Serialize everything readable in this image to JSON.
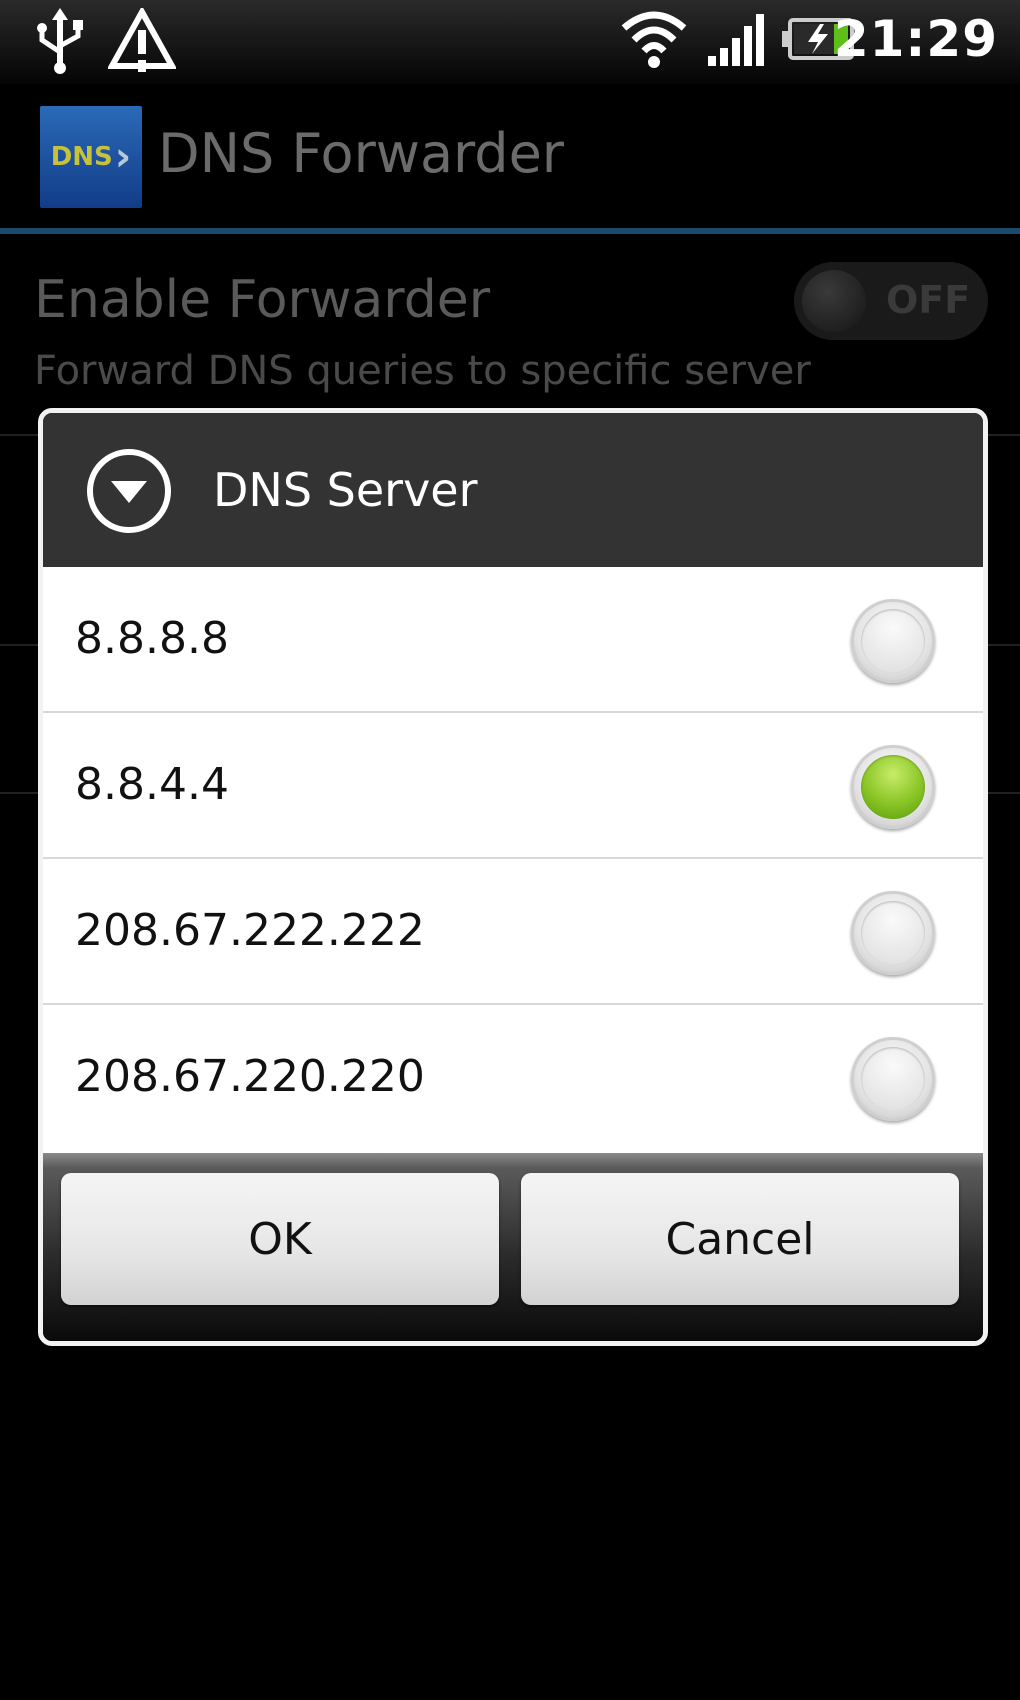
{
  "status_bar": {
    "time": "21:29",
    "icons": [
      "usb-icon",
      "warning-icon",
      "wifi-icon",
      "signal-icon",
      "battery-charging-icon"
    ]
  },
  "app": {
    "logo_text": "DNS",
    "title": "DNS Forwarder"
  },
  "preferences": {
    "enable_forwarder": {
      "title": "Enable Forwarder",
      "summary": "Forward DNS queries to specific server",
      "toggle_label": "OFF"
    }
  },
  "dialog": {
    "title": "DNS Server",
    "options": [
      {
        "label": "8.8.8.8",
        "selected": false
      },
      {
        "label": "8.8.4.4",
        "selected": true
      },
      {
        "label": "208.67.222.222",
        "selected": false
      },
      {
        "label": "208.67.220.220",
        "selected": false
      }
    ],
    "ok_label": "OK",
    "cancel_label": "Cancel"
  },
  "colors": {
    "selected_radio": "#88c424",
    "title_rule": "#1d4a6b"
  }
}
